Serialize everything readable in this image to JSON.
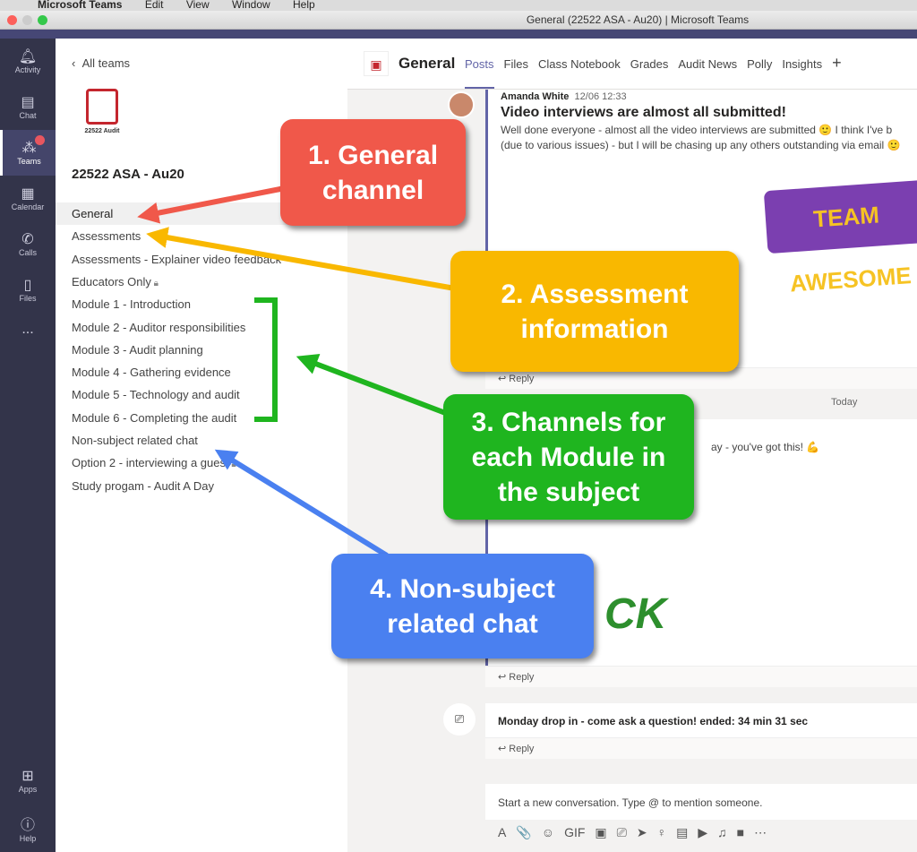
{
  "menubar": {
    "app": "Microsoft Teams",
    "items": [
      "Edit",
      "View",
      "Window",
      "Help"
    ]
  },
  "window_title": "General (22522 ASA - Au20) | Microsoft Teams",
  "rail": [
    {
      "label": "Activity",
      "icon": "bell-icon"
    },
    {
      "label": "Chat",
      "icon": "chat-icon"
    },
    {
      "label": "Teams",
      "icon": "teams-icon",
      "active": true
    },
    {
      "label": "Calendar",
      "icon": "calendar-icon"
    },
    {
      "label": "Calls",
      "icon": "phone-icon"
    },
    {
      "label": "Files",
      "icon": "file-icon"
    },
    {
      "label": "...",
      "icon": "more-icon"
    }
  ],
  "rail_bottom": [
    {
      "label": "Apps",
      "icon": "apps-icon"
    },
    {
      "label": "Help",
      "icon": "help-icon"
    }
  ],
  "channels": {
    "back": "All teams",
    "logo_text": "22522 Audit",
    "team_name": "22522 ASA - Au20",
    "items": [
      "General",
      "Assessments",
      "Assessments - Explainer video feedback",
      "Educators Only",
      "Module 1 - Introduction",
      "Module 2 - Auditor responsibilities",
      "Module 3 - Audit planning",
      "Module 4 - Gathering evidence",
      "Module 5 - Technology and audit",
      "Module 6 - Completing the audit",
      "Non-subject related chat",
      "Option 2 - interviewing a guest",
      "Study progam - Audit A Day"
    ]
  },
  "header": {
    "title": "General",
    "tabs": [
      "Posts",
      "Files",
      "Class Notebook",
      "Grades",
      "Audit News",
      "Polly",
      "Insights"
    ],
    "add": "+"
  },
  "posts": [
    {
      "author": "Amanda White",
      "time": "12/06 12:33",
      "subject": "Video interviews are almost all submitted!",
      "line1": "Well done everyone - almost all the video interviews are submitted 🙂  I think I've b",
      "line2": "(due to various issues) - but I will be chasing up any others outstanding via email 🙂",
      "image_text": "TEAM AWESOME",
      "reply": "Reply"
    },
    {
      "text": "ay - you've got this! 💪",
      "image_text": "CK",
      "reply": "Reply"
    },
    {
      "text": "Monday drop in - come ask a question! ended: 34 min 31 sec",
      "reply": "Reply"
    }
  ],
  "divider": "Today",
  "compose": {
    "placeholder": "Start a new conversation. Type @ to mention someone.",
    "tools": [
      "A",
      "📎",
      "☺",
      "GIF",
      "▣",
      "⎚",
      "➤",
      "♀",
      "▤",
      "▶",
      "♫",
      "■",
      "⋯"
    ]
  },
  "callouts": [
    {
      "text": "1. General channel",
      "color": "#f0584a"
    },
    {
      "text": "2. Assessment information",
      "color": "#f9b800"
    },
    {
      "text": "3. Channels for each Module in the subject",
      "color": "#1fb51f"
    },
    {
      "text": "4. Non-subject related chat",
      "color": "#4a80f0"
    }
  ]
}
